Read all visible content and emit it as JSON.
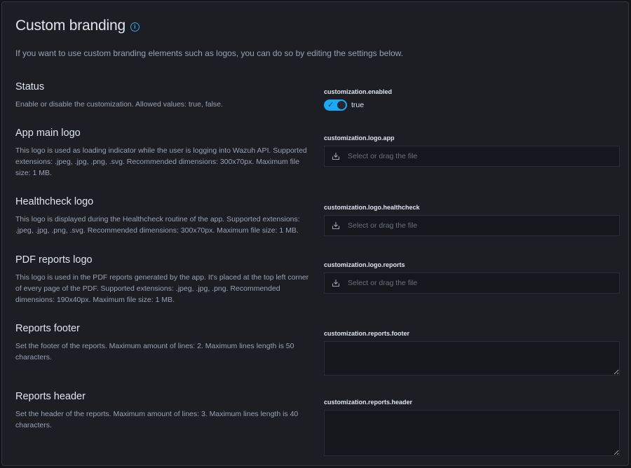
{
  "header": {
    "title": "Custom branding",
    "description": "If you want to use custom branding elements such as logos, you can do so by editing the settings below."
  },
  "settings": [
    {
      "name": "Status",
      "help": "Enable or disable the customization. Allowed values: true, false.",
      "key": "customization.enabled",
      "type": "toggle",
      "value": "true",
      "checked": true
    },
    {
      "name": "App main logo",
      "help": "This logo is used as loading indicator while the user is logging into Wazuh API. Supported extensions: .jpeg, .jpg, .png, .svg. Recommended dimensions: 300x70px. Maximum file size: 1 MB.",
      "key": "customization.logo.app",
      "type": "file",
      "placeholder": "Select or drag the file"
    },
    {
      "name": "Healthcheck logo",
      "help": "This logo is displayed during the Healthcheck routine of the app. Supported extensions: .jpeg, .jpg, .png, .svg. Recommended dimensions: 300x70px. Maximum file size: 1 MB.",
      "key": "customization.logo.healthcheck",
      "type": "file",
      "placeholder": "Select or drag the file"
    },
    {
      "name": "PDF reports logo",
      "help": "This logo is used in the PDF reports generated by the app. It's placed at the top left corner of every page of the PDF. Supported extensions: .jpeg, .jpg, .png. Recommended dimensions: 190x40px. Maximum file size: 1 MB.",
      "key": "customization.logo.reports",
      "type": "file",
      "placeholder": "Select or drag the file"
    },
    {
      "name": "Reports footer",
      "help": "Set the footer of the reports. Maximum amount of lines: 2. Maximum lines length is 50 characters.",
      "key": "customization.reports.footer",
      "type": "textarea",
      "value": ""
    },
    {
      "name": "Reports header",
      "help": "Set the header of the reports. Maximum amount of lines: 3. Maximum lines length is 40 characters.",
      "key": "customization.reports.header",
      "type": "textarea",
      "value": ""
    }
  ],
  "icons": {
    "info": "info-icon",
    "upload": "download-tray-icon",
    "toggle_check": "check-icon"
  },
  "colors": {
    "accent": "#1ba9f5",
    "info": "#36a2ef",
    "background": "#1d1e24"
  }
}
